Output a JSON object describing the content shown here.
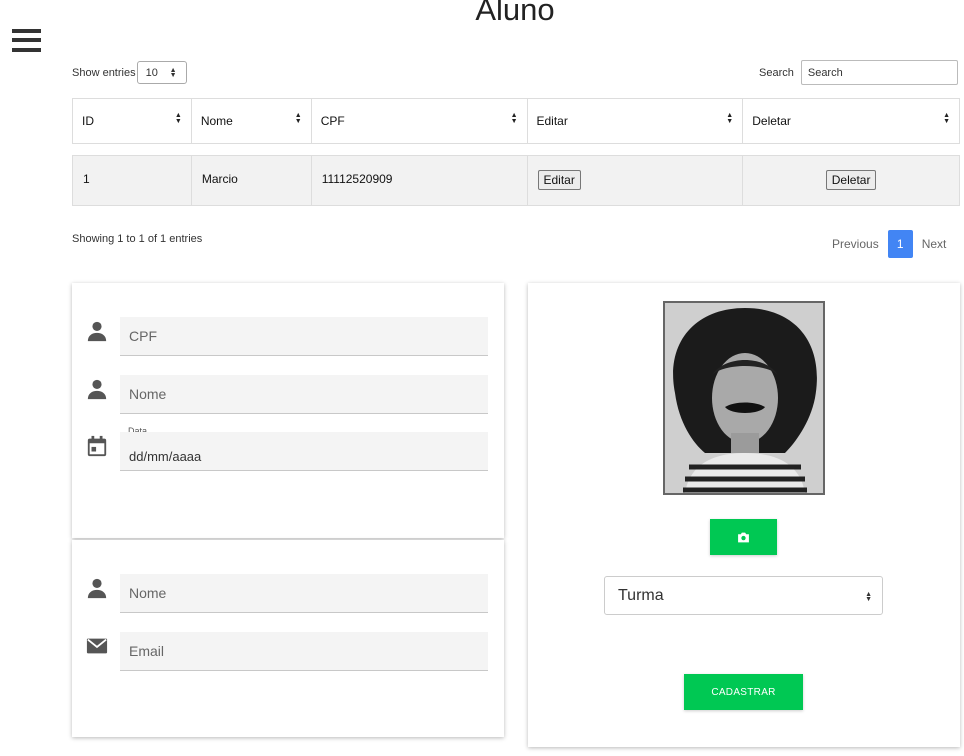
{
  "header": {
    "title": "Aluno"
  },
  "table_controls": {
    "length_label": "Show entries",
    "length_value": "10",
    "search_label": "Search",
    "search_placeholder": "Search"
  },
  "table": {
    "columns": [
      "ID",
      "Nome",
      "CPF",
      "Editar",
      "Deletar"
    ],
    "rows": [
      {
        "id": "1",
        "nome": "Marcio",
        "cpf": "11112520909",
        "edit_label": "Editar",
        "delete_label": "Deletar"
      }
    ]
  },
  "table_footer": {
    "info": "Showing 1 to 1 of 1 entries",
    "prev_label": "Previous",
    "page": "1",
    "next_label": "Next"
  },
  "form_a": {
    "cpf_placeholder": "CPF",
    "nome_placeholder": "Nome",
    "data_label": "Data",
    "data_value": "dd/mm/aaaa"
  },
  "form_b": {
    "nome_placeholder": "Nome",
    "email_placeholder": "Email"
  },
  "form_c": {
    "turma_value": "Turma",
    "submit_label": "CADASTRAR"
  },
  "colors": {
    "accent_green": "#00c853",
    "page_active": "#4285f4"
  },
  "icons": [
    "menu-icon",
    "person-icon",
    "calendar-icon",
    "email-icon",
    "camera-icon"
  ]
}
